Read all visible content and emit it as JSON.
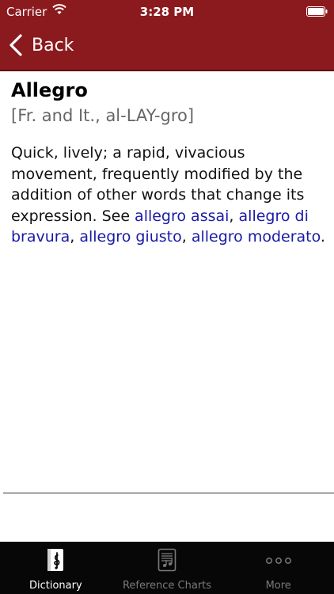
{
  "status": {
    "carrier": "Carrier",
    "time": "3:28 PM"
  },
  "nav": {
    "back_label": "Back"
  },
  "entry": {
    "term": "Allegro",
    "pronunciation": "[Fr. and It., al-LAY-gro]",
    "definition_text": "Quick, lively; a rapid, vivacious movement, frequently modified by the addition of other words that change its expression. See ",
    "links": [
      {
        "text": "allegro assai",
        "sep": ", "
      },
      {
        "text": "allegro di bravura",
        "sep": ", "
      },
      {
        "text": "allegro giusto",
        "sep": ", "
      },
      {
        "text": "allegro moderato",
        "sep": "."
      }
    ]
  },
  "tabs": [
    {
      "label": "Dictionary",
      "icon": "dictionary-icon",
      "active": true
    },
    {
      "label": "Reference Charts",
      "icon": "reference-charts-icon",
      "active": false
    },
    {
      "label": "More",
      "icon": "more-icon",
      "active": false
    }
  ],
  "colors": {
    "header": "#8b1a1e",
    "link": "#1a1aa6",
    "tabbar": "#070707"
  }
}
